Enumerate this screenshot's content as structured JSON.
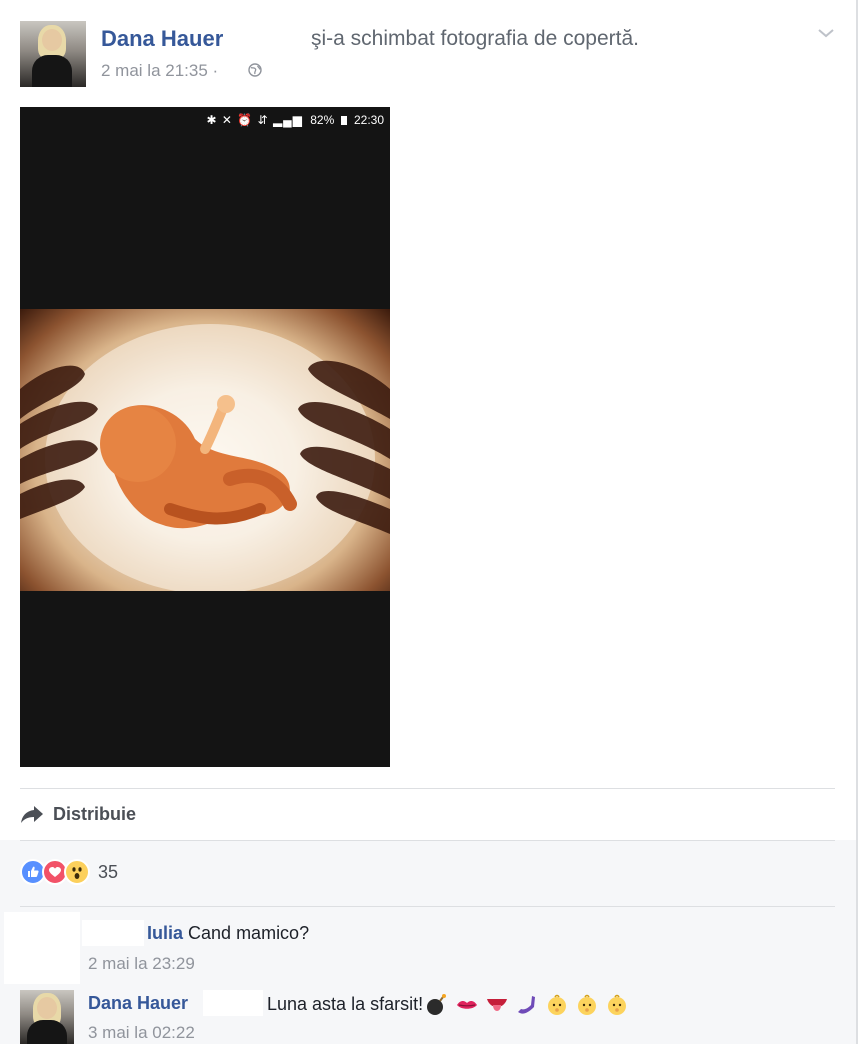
{
  "post": {
    "author": "Dana Hauer",
    "action": "şi-a schimbat fotografia de copertă.",
    "timestamp": "2 mai la 21:35 ·",
    "privacy_icon": "globe-icon",
    "menu_icon": "chevron-down-icon"
  },
  "photo": {
    "status_bar": {
      "icons": "✱ ✕ ⏰ ⇵ ▂▄▆",
      "battery": "82%",
      "time": "22:30"
    }
  },
  "actions": {
    "share_label": "Distribuie",
    "share_icon": "share-arrow-icon"
  },
  "reactions": {
    "types": [
      "like",
      "love",
      "wow"
    ],
    "count": "35",
    "colors": {
      "like": "#5890ff",
      "love": "#f25268",
      "wow": "#fcd05c"
    }
  },
  "comments": [
    {
      "author": "Iulia",
      "text": "Cand mamico?",
      "time": "2 mai la 23:29"
    },
    {
      "author": "Dana Hauer",
      "text": "Luna asta la sfarsit!",
      "time": "3 mai la 02:22",
      "emojis": [
        "bomb-icon",
        "kiss-mark-icon",
        "tongue-icon",
        "phone-icon",
        "baby-icon",
        "baby-icon",
        "baby-icon"
      ]
    }
  ],
  "colors": {
    "link_blue": "#365899",
    "muted_gray": "#90949c",
    "comments_bg": "#f6f7f9"
  }
}
